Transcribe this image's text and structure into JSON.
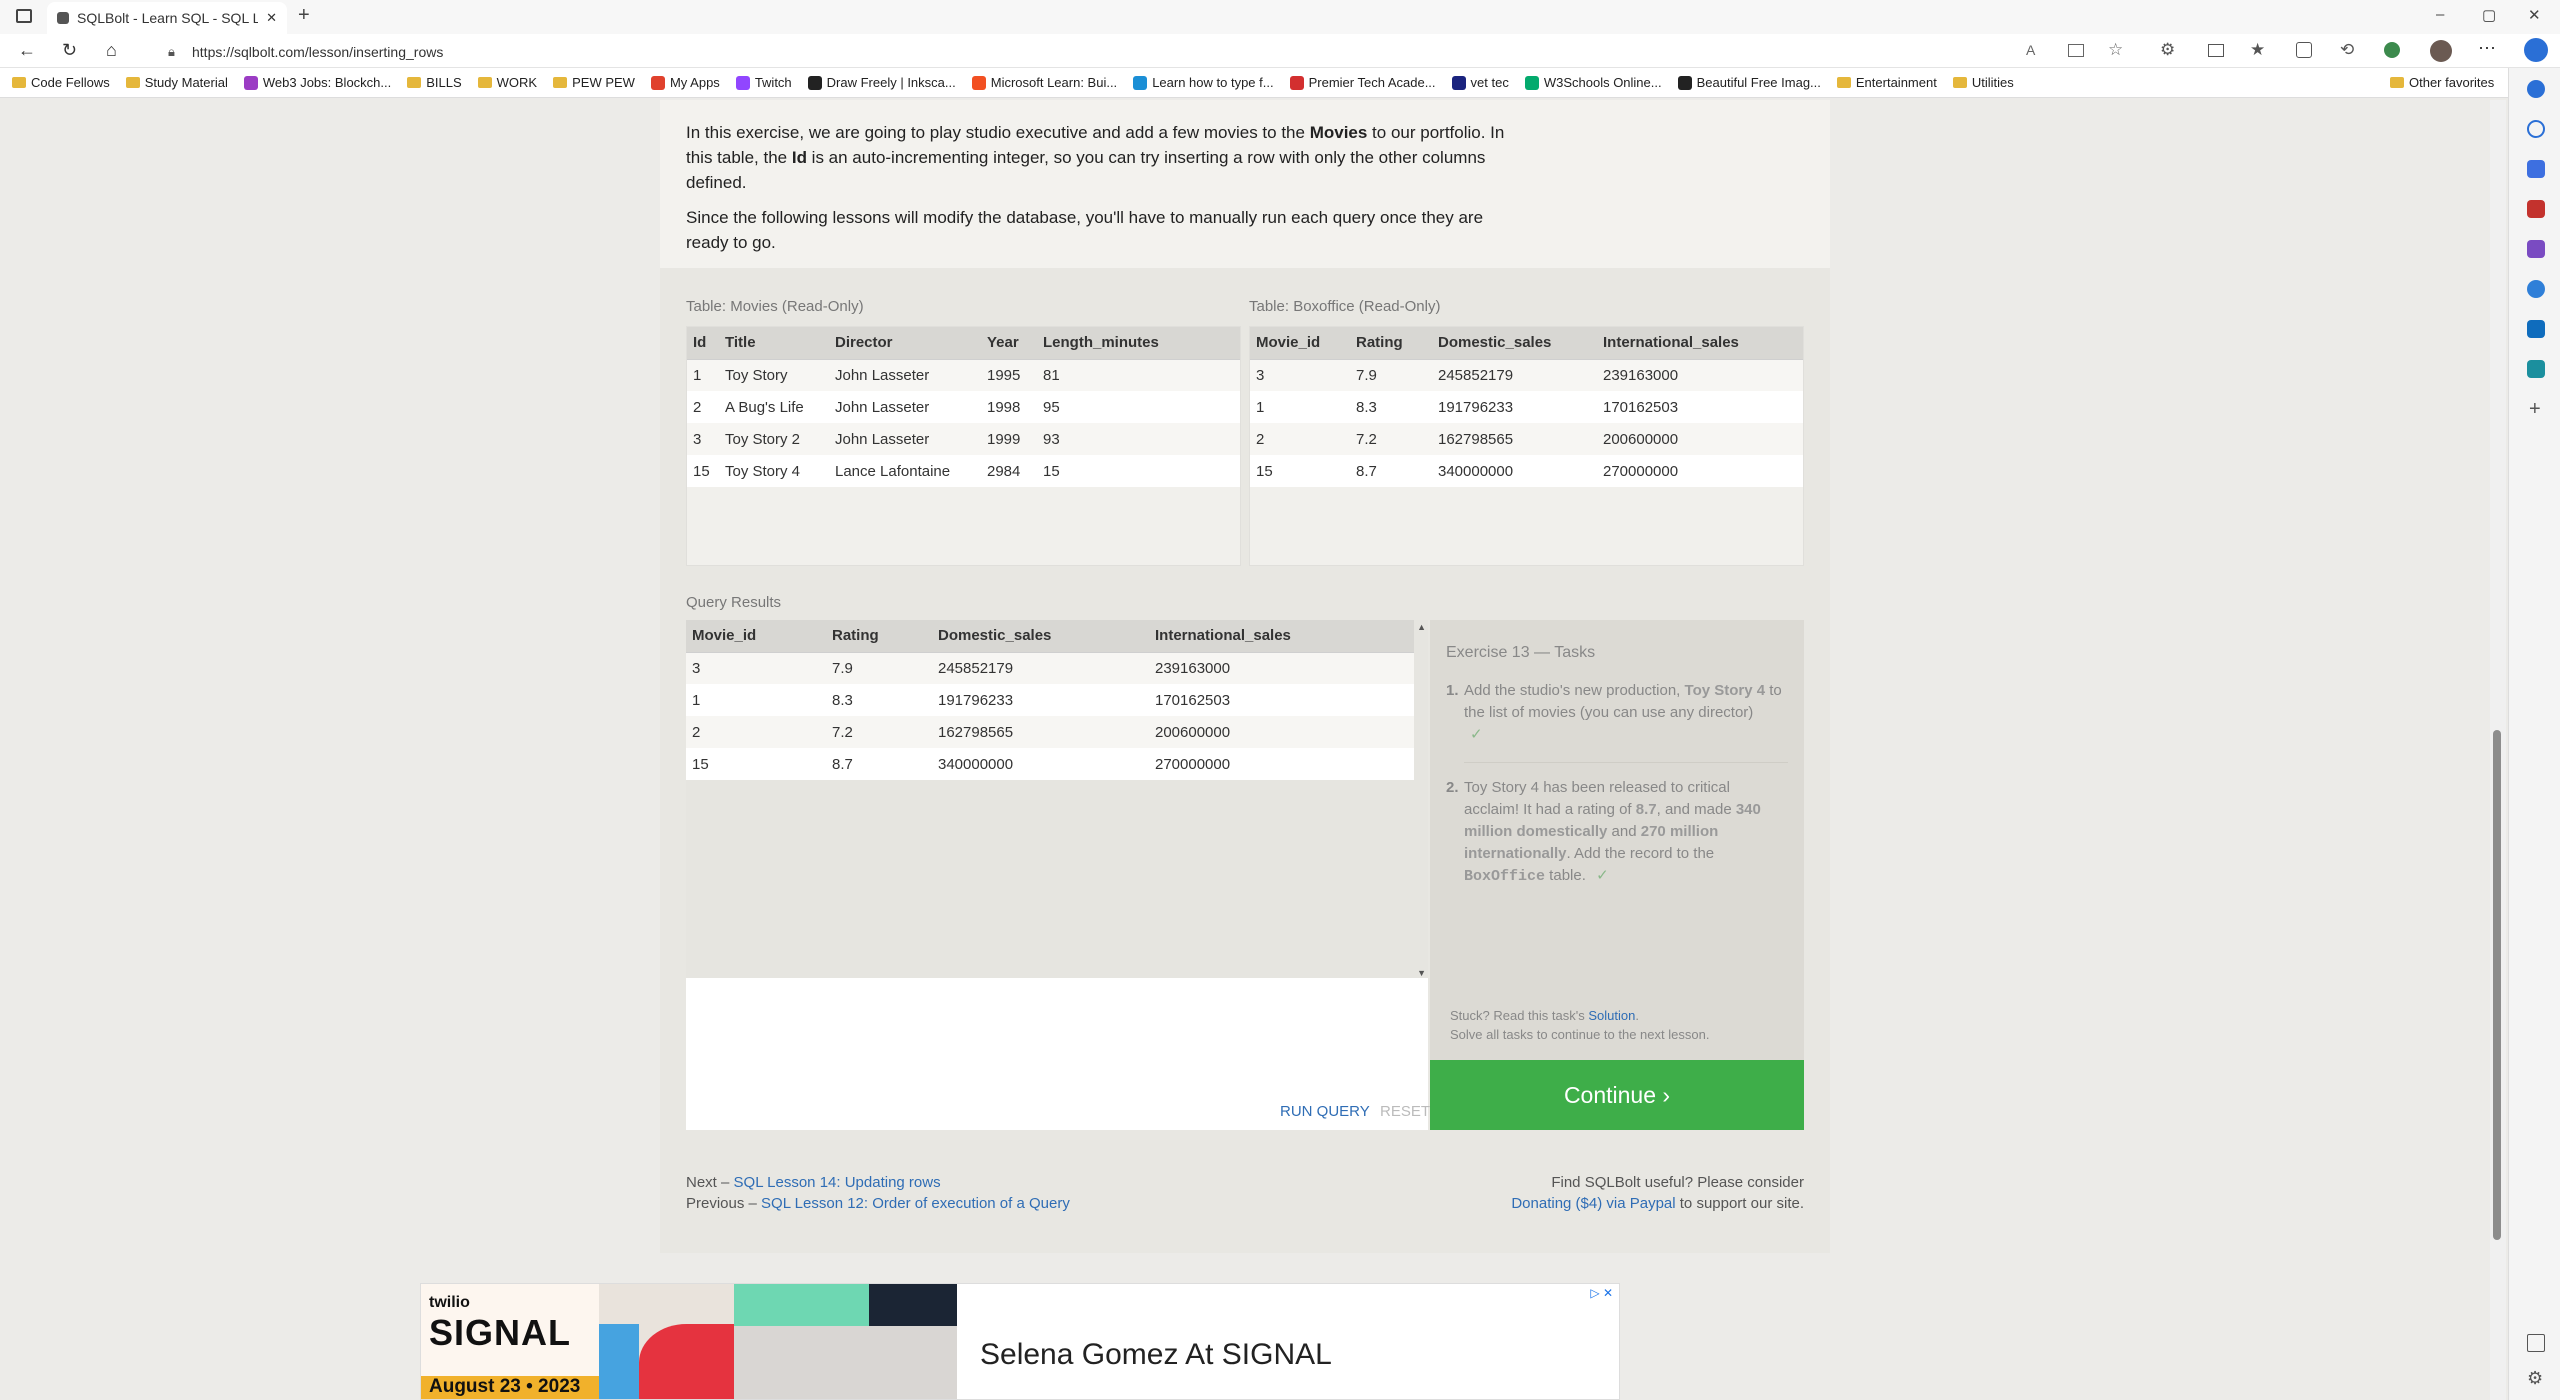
{
  "browser": {
    "tab_title": "SQLBolt - Learn SQL - SQL Lesso",
    "url": "https://sqlbolt.com/lesson/inserting_rows",
    "window_controls": {
      "minimize": "–",
      "maximize": "▢",
      "close": "✕"
    }
  },
  "bookmarks": [
    {
      "label": "Code Fellows",
      "icon": "folder-icon"
    },
    {
      "label": "Study Material",
      "icon": "folder-icon"
    },
    {
      "label": "Web3 Jobs: Blockch...",
      "icon": "web3-icon"
    },
    {
      "label": "BILLS",
      "icon": "folder-icon"
    },
    {
      "label": "WORK",
      "icon": "folder-icon"
    },
    {
      "label": "PEW PEW",
      "icon": "folder-icon"
    },
    {
      "label": "My Apps",
      "icon": "apps-icon"
    },
    {
      "label": "Twitch",
      "icon": "twitch-icon"
    },
    {
      "label": "Draw Freely | Inksca...",
      "icon": "inkscape-icon"
    },
    {
      "label": "Microsoft Learn: Bui...",
      "icon": "microsoft-icon"
    },
    {
      "label": "Learn how to type f...",
      "icon": "typing-icon"
    },
    {
      "label": "Premier Tech Acade...",
      "icon": "shield-icon"
    },
    {
      "label": "vet tec",
      "icon": "vettec-icon"
    },
    {
      "label": "W3Schools Online...",
      "icon": "w3schools-icon"
    },
    {
      "label": "Beautiful Free Imag...",
      "icon": "unsplash-icon"
    },
    {
      "label": "Entertainment",
      "icon": "folder-icon"
    },
    {
      "label": "Utilities",
      "icon": "folder-icon"
    }
  ],
  "other_favorites": "Other favorites",
  "intro": {
    "p1_a": "In this exercise, we are going to play studio executive and add a few movies to the ",
    "p1_bold1": "Movies",
    "p1_b": " to our portfolio. In this table, the ",
    "p1_bold2": "Id",
    "p1_c": " is an auto-incrementing integer, so you can try inserting a row with only the other columns defined.",
    "p2": "Since the following lessons will modify the database, you'll have to manually run each query once they are ready to go."
  },
  "movies": {
    "caption": "Table: Movies (Read-Only)",
    "columns": [
      "Id",
      "Title",
      "Director",
      "Year",
      "Length_minutes"
    ],
    "rows": [
      [
        "1",
        "Toy Story",
        "John Lasseter",
        "1995",
        "81"
      ],
      [
        "2",
        "A Bug's Life",
        "John Lasseter",
        "1998",
        "95"
      ],
      [
        "3",
        "Toy Story 2",
        "John Lasseter",
        "1999",
        "93"
      ],
      [
        "15",
        "Toy Story 4",
        "Lance Lafontaine",
        "2984",
        "15"
      ]
    ]
  },
  "boxoffice": {
    "caption": "Table: Boxoffice (Read-Only)",
    "columns": [
      "Movie_id",
      "Rating",
      "Domestic_sales",
      "International_sales"
    ],
    "rows": [
      [
        "3",
        "7.9",
        "245852179",
        "239163000"
      ],
      [
        "1",
        "8.3",
        "191796233",
        "170162503"
      ],
      [
        "2",
        "7.2",
        "162798565",
        "200600000"
      ],
      [
        "15",
        "8.7",
        "340000000",
        "270000000"
      ]
    ]
  },
  "results": {
    "caption": "Query Results",
    "columns": [
      "Movie_id",
      "Rating",
      "Domestic_sales",
      "International_sales"
    ],
    "rows": [
      [
        "3",
        "7.9",
        "245852179",
        "239163000"
      ],
      [
        "1",
        "8.3",
        "191796233",
        "170162503"
      ],
      [
        "2",
        "7.2",
        "162798565",
        "200600000"
      ],
      [
        "15",
        "8.7",
        "340000000",
        "270000000"
      ]
    ]
  },
  "tasks": {
    "title": "Exercise 13 — Tasks",
    "t1_num": "1.",
    "t1_a": "Add the studio's new production, ",
    "t1_b": "Toy Story 4",
    "t1_c": " to the list of movies (you can use any director)",
    "t2_num": "2.",
    "t2_a": "Toy Story 4 has been released to critical acclaim! It had a rating of ",
    "t2_b": "8.7",
    "t2_c": ", and made ",
    "t2_d": "340 million domestically",
    "t2_e": " and ",
    "t2_f": "270 million internationally",
    "t2_g": ". Add the record to the ",
    "t2_h": "BoxOffice",
    "t2_i": " table.",
    "check": "✓",
    "stuck_a": "Stuck? Read this task's ",
    "stuck_link": "Solution",
    "stuck_b": ".",
    "solve_all": "Solve all tasks to continue to the next lesson."
  },
  "controls": {
    "run": "RUN QUERY",
    "reset": "RESET",
    "continue": "Continue ›"
  },
  "nav": {
    "next_prefix": "Next – ",
    "next_link": "SQL Lesson 14: Updating rows",
    "prev_prefix": "Previous – ",
    "prev_link": "SQL Lesson 12: Order of execution of a Query"
  },
  "donate": {
    "line1": "Find SQLBolt useful? Please consider",
    "link": "Donating ($4) via Paypal",
    "suffix": " to support our site."
  },
  "ad": {
    "brand_top": "twilio",
    "brand": "SIGNAL",
    "date": "August 23 • 2023",
    "headline": "Selena Gomez At SIGNAL"
  }
}
